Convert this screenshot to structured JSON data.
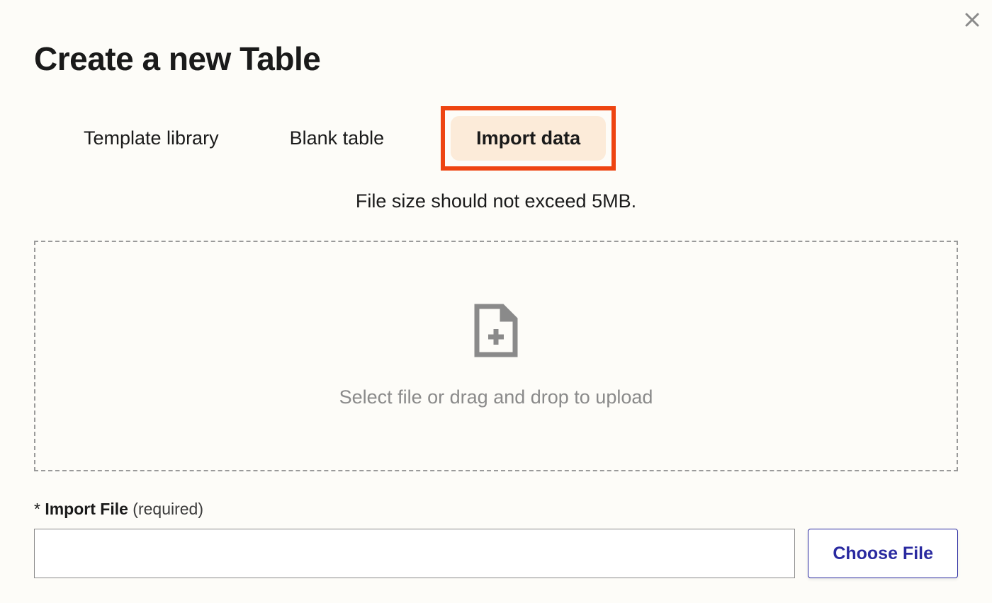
{
  "title": "Create a new Table",
  "tabs": {
    "template_library": "Template library",
    "blank_table": "Blank table",
    "import_data": "Import data"
  },
  "hint": "File size should not exceed 5MB.",
  "dropzone": {
    "text": "Select file or drag and drop to upload"
  },
  "field": {
    "asterisk": "*",
    "label": "Import File",
    "required": "(required)",
    "value": ""
  },
  "choose_file_label": "Choose File"
}
